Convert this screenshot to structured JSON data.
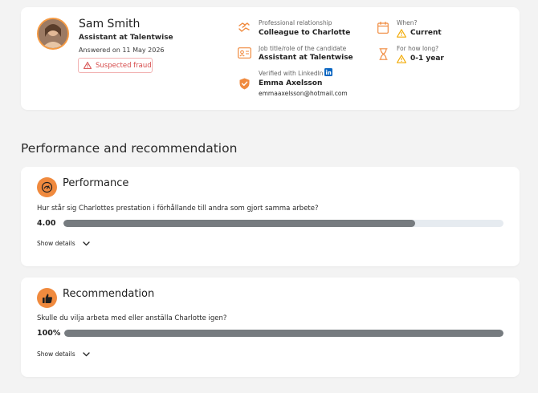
{
  "reference": {
    "name": "Sam Smith",
    "role": "Assistant at Talentwise",
    "answered": "Answered on 11 May 2026",
    "fraud_label": "Suspected fraud",
    "fields": {
      "relationship_label": "Professional relationship",
      "relationship_value": "Colleague to Charlotte",
      "job_title_label": "Job title/role of the candidate",
      "job_title_value": "Assistant at Talentwise",
      "verified_label": "Verified with LinkedIn",
      "verified_name": "Emma Axelsson",
      "verified_email": "emmaaxelsson@hotmail.com",
      "when_label": "When?",
      "when_value": "Current",
      "how_long_label": "For how long?",
      "how_long_value": "0-1 year"
    },
    "icons": [
      "avatar-photo",
      "handshake-icon",
      "id-card-icon",
      "shield-check-icon",
      "calendar-icon",
      "hourglass-icon",
      "warning-icon",
      "linkedin-icon"
    ]
  },
  "section_title": "Performance and recommendation",
  "performance": {
    "title": "Performance",
    "question": "Hur står sig Charlottes prestation i förhållande till andra som gjort samma arbete?",
    "score_text": "4.00",
    "score_fraction": 0.8,
    "details_label": "Show details",
    "icon": "meter-icon"
  },
  "recommendation": {
    "title": "Recommendation",
    "question": "Skulle du vilja arbeta med eller anställa Charlotte igen?",
    "score_text": "100%",
    "score_fraction": 1.0,
    "details_label": "Show details",
    "icon": "thumbs-up-icon"
  },
  "colors": {
    "accent": "#f08a3e",
    "fraud": "#d64a4a",
    "bar_fill": "#767b7f",
    "bar_track": "#e6ebf0",
    "warning": "#f2a900",
    "linkedin": "#0a66c2"
  }
}
